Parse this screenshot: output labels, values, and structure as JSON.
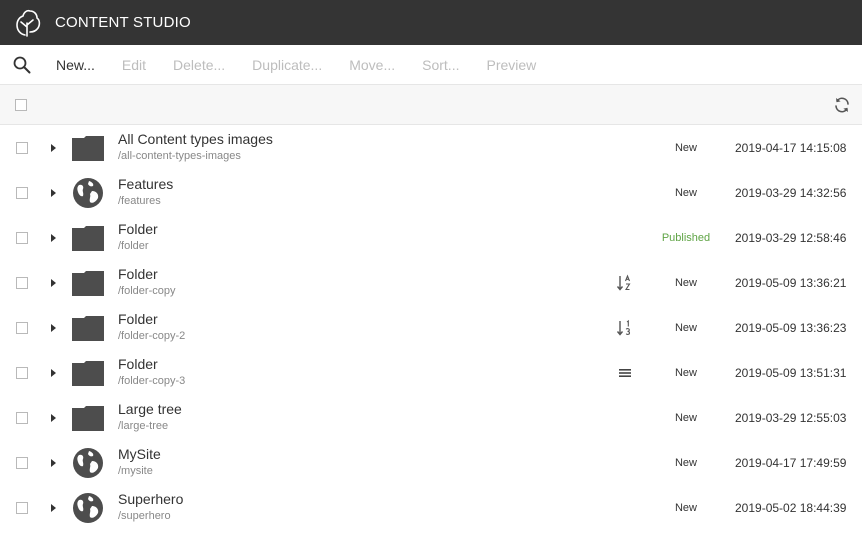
{
  "header": {
    "title": "CONTENT STUDIO",
    "logo_icon": "tree-logo-icon"
  },
  "toolbar": {
    "search_icon": "search-icon",
    "buttons": [
      {
        "label": "New...",
        "enabled": true
      },
      {
        "label": "Edit",
        "enabled": false
      },
      {
        "label": "Delete...",
        "enabled": false
      },
      {
        "label": "Duplicate...",
        "enabled": false
      },
      {
        "label": "Move...",
        "enabled": false
      },
      {
        "label": "Sort...",
        "enabled": false
      },
      {
        "label": "Preview",
        "enabled": false
      }
    ]
  },
  "grid_toolbar": {
    "refresh_icon": "refresh-icon"
  },
  "colors": {
    "header_bg": "#343434",
    "published": "#5fa445",
    "icon": "#4d4d4d",
    "disabled_text": "#bdbdbd"
  },
  "rows": [
    {
      "display_name": "All Content types images",
      "path": "/all-content-types-images",
      "icon": "folder-icon",
      "order_icon": "",
      "status": "New",
      "modified": "2019-04-17 14:15:08"
    },
    {
      "display_name": "Features",
      "path": "/features",
      "icon": "globe-icon",
      "order_icon": "",
      "status": "New",
      "modified": "2019-03-29 14:32:56"
    },
    {
      "display_name": "Folder",
      "path": "/folder",
      "icon": "folder-icon",
      "order_icon": "",
      "status": "Published",
      "modified": "2019-03-29 12:58:46"
    },
    {
      "display_name": "Folder",
      "path": "/folder-copy",
      "icon": "folder-icon",
      "order_icon": "sort-alpha-icon",
      "status": "New",
      "modified": "2019-05-09 13:36:21"
    },
    {
      "display_name": "Folder",
      "path": "/folder-copy-2",
      "icon": "folder-icon",
      "order_icon": "sort-numeric-icon",
      "status": "New",
      "modified": "2019-05-09 13:36:23"
    },
    {
      "display_name": "Folder",
      "path": "/folder-copy-3",
      "icon": "folder-icon",
      "order_icon": "manual-order-icon",
      "status": "New",
      "modified": "2019-05-09 13:51:31"
    },
    {
      "display_name": "Large tree",
      "path": "/large-tree",
      "icon": "folder-icon",
      "order_icon": "",
      "status": "New",
      "modified": "2019-03-29 12:55:03"
    },
    {
      "display_name": "MySite",
      "path": "/mysite",
      "icon": "globe-icon",
      "order_icon": "",
      "status": "New",
      "modified": "2019-04-17 17:49:59"
    },
    {
      "display_name": "Superhero",
      "path": "/superhero",
      "icon": "globe-icon",
      "order_icon": "",
      "status": "New",
      "modified": "2019-05-02 18:44:39"
    }
  ]
}
